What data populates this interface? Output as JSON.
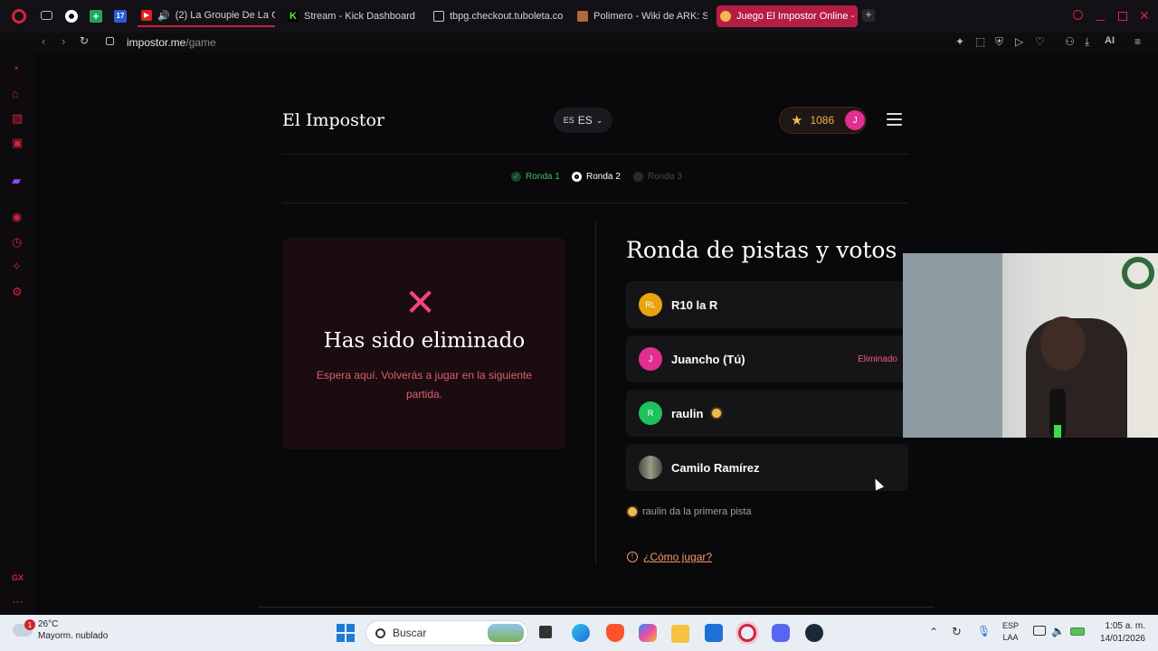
{
  "browser": {
    "tabs": [
      {
        "label": "(2) La Groupie De La G",
        "favicon_color": "#e02020"
      },
      {
        "label": "Stream - Kick Dashboard",
        "favicon_color": "#53fc18"
      },
      {
        "label": "tbpg.checkout.tuboleta.co",
        "favicon_color": "#cccccc"
      },
      {
        "label": "Polimero - Wiki de ARK: S",
        "favicon_color": "#b06a3b"
      },
      {
        "label": "Juego El Impostor Online -",
        "favicon_color": "#f2b84b"
      }
    ],
    "pinned_badge": "17",
    "url_host": "impostor.me",
    "url_path": "/game",
    "ai_label": "AI",
    "sidebar_gx": "GX"
  },
  "app": {
    "brand": "El Impostor",
    "lang_small": "ES",
    "lang": "ES",
    "points": "1086",
    "user_initial": "J",
    "accent": "#e12e8f"
  },
  "rounds": [
    {
      "label": "Ronda 1",
      "state": "done"
    },
    {
      "label": "Ronda 2",
      "state": "current"
    },
    {
      "label": "Ronda 3",
      "state": "pending"
    }
  ],
  "eliminated": {
    "title": "Has sido eliminado",
    "message": "Espera aquí. Volverás a jugar en la siguiente partida."
  },
  "voting": {
    "title": "Ronda de pistas y votos",
    "players": [
      {
        "initials": "RL",
        "name": "R10 la R",
        "color": "#e8a40f",
        "status": ""
      },
      {
        "initials": "J",
        "name": "Juancho (Tú)",
        "color": "#e12e8f",
        "status": "Eliminado"
      },
      {
        "initials": "R",
        "name": "raulin",
        "color": "#1ec15a",
        "status": ""
      },
      {
        "initials": "",
        "name": "Camilo Ramírez",
        "color": "#6d6a5e",
        "status": ""
      }
    ],
    "hint": "raulin da la primera pista",
    "how_to": "¿Cómo jugar?"
  },
  "taskbar": {
    "temp": "26°C",
    "weather": "Mayorm. nublado",
    "weather_badge": "1",
    "search": "Buscar",
    "lang1": "ESP",
    "lang2": "LAA",
    "time": "1:05 a. m.",
    "date": "14/01/2026"
  }
}
